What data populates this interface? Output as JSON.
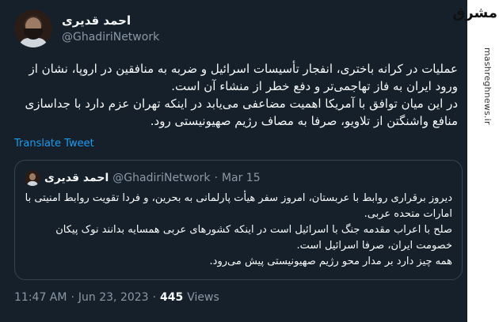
{
  "author": {
    "display_name": "احمد قدیری",
    "handle": "@GhadiriNetwork"
  },
  "tweet": {
    "lines": [
      "عملیات در کرانه باختری، انفجار تأسیسات اسرائیل و ضربه به منافقین در اروپا، نشان از ورود ایران به فاز تهاجمی‌تر و دفع خطر از منشاء آن است.",
      "در این میان توافق با آمریکا اهمیت مضاعفی می‌یابد در اینکه تهران عزم دارد با جداسازی منافع واشنگتن از تلاویو، صرفا به مصاف رژیم صهیونیستی رود."
    ],
    "translate_label": "Translate Tweet"
  },
  "quoted": {
    "display_name": "احمد قدیری",
    "handle": "@GhadiriNetwork",
    "separator": "·",
    "date": "Mar 15",
    "lines": [
      "دیروز برقراری روابط با عربستان، امروز سفر هیأت پارلمانی به بحرین، و فردا تقویت روابط امنیتی با امارات متحده عربی.",
      "صلح با اعراب مقدمه جنگ با اسرائیل است در اینکه کشورهای عربی همسایه بدانند نوک پیکان خصومت ایران، صرفا اسرائیل است.",
      "همه چیز دارد بر مدار محو رژیم صهیونیستی پیش می‌رود."
    ]
  },
  "meta": {
    "time": "11:47 AM",
    "separator": "·",
    "date": "Jun 23, 2023",
    "views_count": "445",
    "views_label": "Views"
  },
  "watermark": {
    "logo": "مشرق",
    "url": "mashreghnews.ir"
  }
}
